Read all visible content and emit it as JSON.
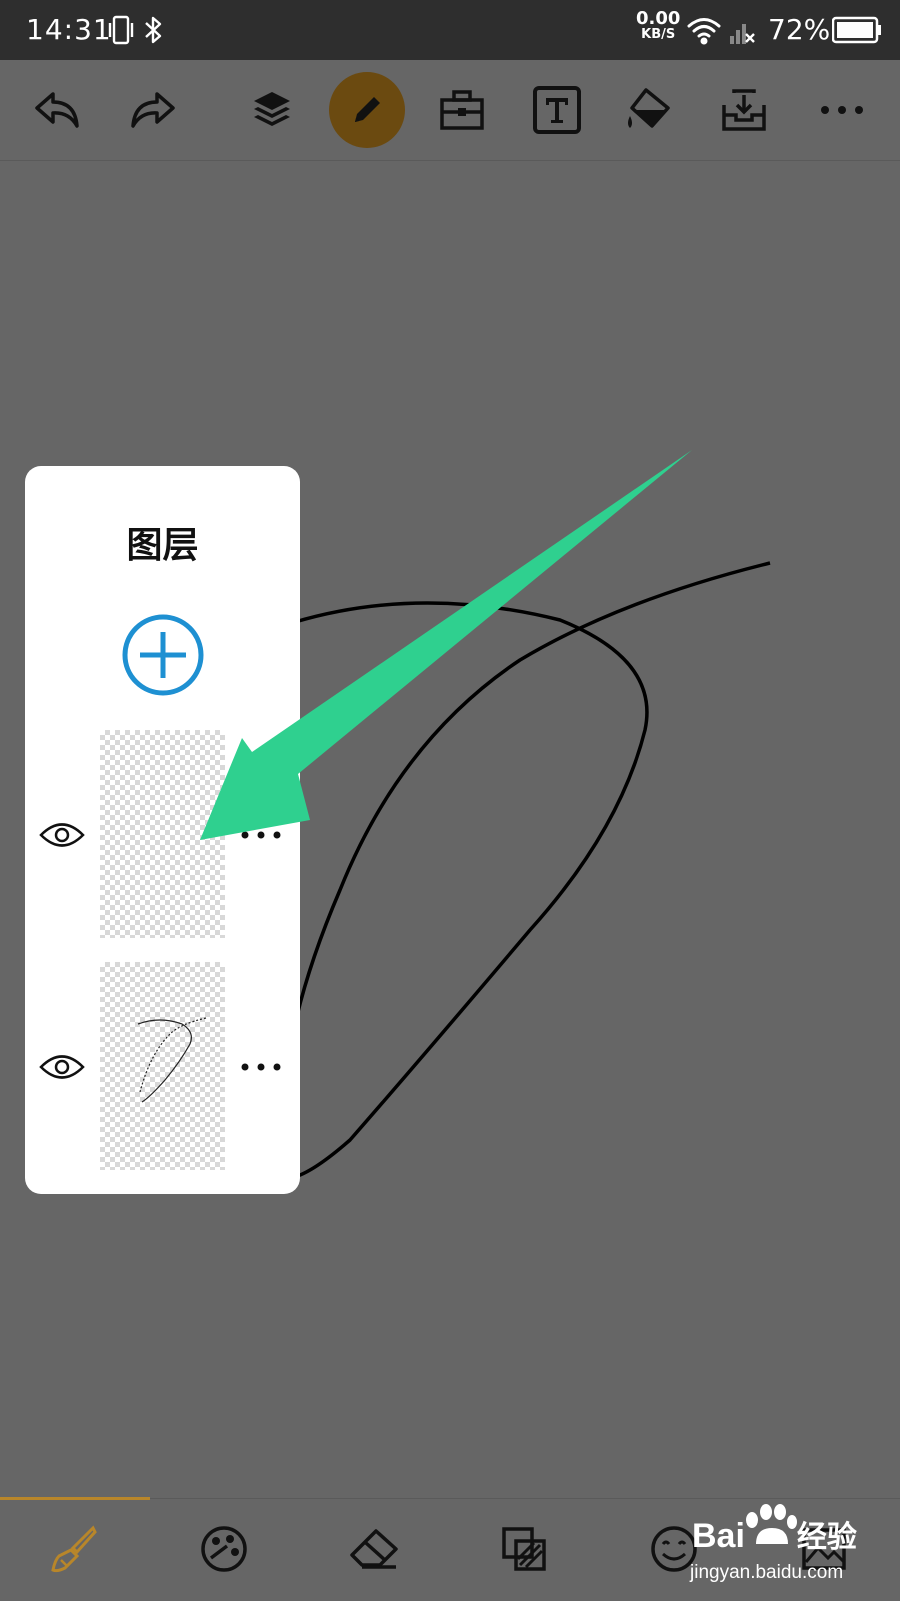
{
  "status_bar": {
    "time": "14:31",
    "net_speed_value": "0.00",
    "net_speed_unit": "KB/S",
    "battery_percent": "72%",
    "icons": [
      "vibrate-icon",
      "bluetooth-icon",
      "wifi-icon",
      "signal-no-sim-icon",
      "battery-icon"
    ]
  },
  "toolbar": {
    "items": [
      {
        "name": "undo-icon"
      },
      {
        "name": "redo-icon"
      },
      {
        "name": "layers-icon"
      },
      {
        "name": "pencil-icon",
        "active": true
      },
      {
        "name": "toolbox-icon"
      },
      {
        "name": "text-icon",
        "glyph": "T"
      },
      {
        "name": "paint-bucket-icon"
      },
      {
        "name": "save-tray-icon"
      },
      {
        "name": "more-icon"
      }
    ],
    "active_color": "#6b4a10"
  },
  "layers_panel": {
    "title": "图层",
    "add_button_color": "#1e90d2",
    "layers": [
      {
        "visible": true,
        "thumbnail": "empty"
      },
      {
        "visible": true,
        "thumbnail": "curve-sketch"
      }
    ]
  },
  "annotation": {
    "arrow_color": "#2fd08f"
  },
  "bottom_bar": {
    "items": [
      "brush-icon",
      "palette-icon",
      "eraser-icon",
      "layer-blend-icon",
      "emoji-icon",
      "image-icon"
    ],
    "active_color": "#b8862a"
  },
  "watermark": {
    "brand": "Bai",
    "brand_cn": "经验",
    "url": "jingyan.baidu.com"
  }
}
